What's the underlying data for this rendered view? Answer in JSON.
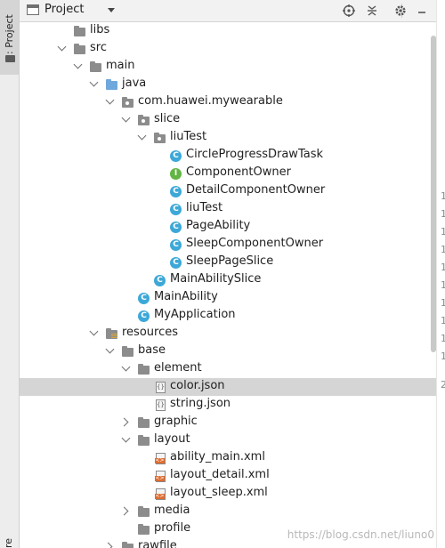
{
  "sidebar": {
    "tab_label": "1: Project",
    "bottom_label": "re"
  },
  "header": {
    "title": "Project",
    "icons": [
      "target-icon",
      "collapse-all-icon",
      "gear-icon",
      "minimize-icon"
    ]
  },
  "tree": {
    "items": [
      {
        "label": "libs",
        "icon": "folder"
      },
      {
        "label": "src",
        "icon": "folder"
      },
      {
        "label": "main",
        "icon": "folder"
      },
      {
        "label": "java",
        "icon": "source-folder"
      },
      {
        "label": "com.huawei.mywearable",
        "icon": "package"
      },
      {
        "label": "slice",
        "icon": "package"
      },
      {
        "label": "liuTest",
        "icon": "package"
      },
      {
        "label": "CircleProgressDrawTask",
        "icon": "class"
      },
      {
        "label": "ComponentOwner",
        "icon": "interface"
      },
      {
        "label": "DetailComponentOwner",
        "icon": "class"
      },
      {
        "label": "liuTest",
        "icon": "class"
      },
      {
        "label": "PageAbility",
        "icon": "class"
      },
      {
        "label": "SleepComponentOwner",
        "icon": "class"
      },
      {
        "label": "SleepPageSlice",
        "icon": "class"
      },
      {
        "label": "MainAbilitySlice",
        "icon": "class"
      },
      {
        "label": "MainAbility",
        "icon": "class"
      },
      {
        "label": "MyApplication",
        "icon": "class"
      },
      {
        "label": "resources",
        "icon": "resources-folder"
      },
      {
        "label": "base",
        "icon": "folder"
      },
      {
        "label": "element",
        "icon": "folder"
      },
      {
        "label": "color.json",
        "icon": "json-file",
        "selected": true
      },
      {
        "label": "string.json",
        "icon": "json-file"
      },
      {
        "label": "graphic",
        "icon": "folder"
      },
      {
        "label": "layout",
        "icon": "folder"
      },
      {
        "label": "ability_main.xml",
        "icon": "xml-file"
      },
      {
        "label": "layout_detail.xml",
        "icon": "xml-file"
      },
      {
        "label": "layout_sleep.xml",
        "icon": "xml-file"
      },
      {
        "label": "media",
        "icon": "folder"
      },
      {
        "label": "profile",
        "icon": "folder"
      },
      {
        "label": "rawfile",
        "icon": "folder"
      }
    ]
  },
  "gutter": {
    "numbers": [
      "1",
      "1",
      "1",
      "1",
      "1",
      "1",
      "1",
      "1",
      "1",
      "1",
      "2"
    ]
  },
  "watermark": "https://blog.csdn.net/liuno0",
  "colors": {
    "class_icon": "#3da8d8",
    "interface_icon": "#62b543",
    "selection": "#d5d5d5",
    "xml_badge": "#e06c2f"
  }
}
